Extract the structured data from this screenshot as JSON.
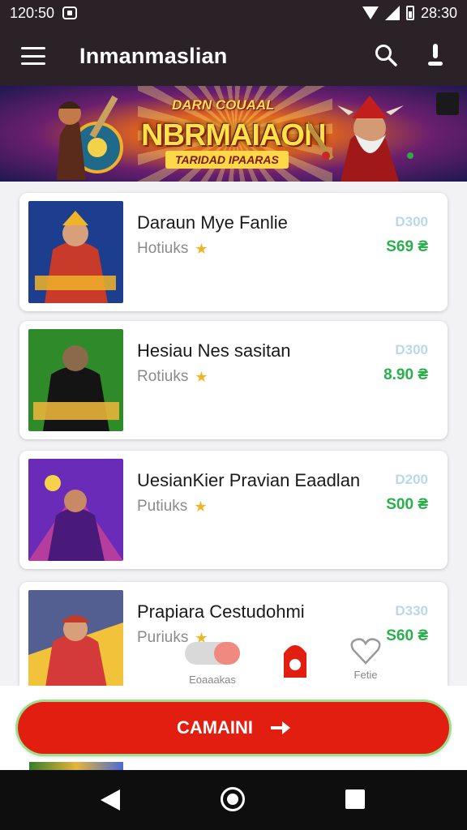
{
  "status_bar": {
    "time_left": "120:50",
    "time_right": "28:30"
  },
  "app_bar": {
    "title": "Inmanmaslian"
  },
  "banner": {
    "kicker": "DARN COUAAL",
    "headline": "NBRMAIAON",
    "subline": "TARIDAD IPAARAS"
  },
  "items": [
    {
      "title": "Daraun Mye Fanlie",
      "subtitle": "Hotiuks",
      "price_old": "D300",
      "price_new": "S69 ₴",
      "thumb_colors": [
        "#1d3d8f",
        "#c83a2a",
        "#f0b429"
      ]
    },
    {
      "title": "Hesiau Nes sasitan",
      "subtitle": "Rotiuks",
      "price_old": "D300",
      "price_new": "8.90 ₴",
      "thumb_colors": [
        "#2f8a2a",
        "#141414",
        "#e8b23a"
      ]
    },
    {
      "title": "UesianKier Pravian Eaadlan",
      "subtitle": "Putiuks",
      "price_old": "D200",
      "price_new": "S00 ₴",
      "thumb_colors": [
        "#6a2bb8",
        "#e84a8a",
        "#f5d24a"
      ]
    },
    {
      "title": "Prapiara Cestudohmi",
      "subtitle": "Puriuks",
      "price_old": "D330",
      "price_new": "S60 ₴",
      "thumb_colors": [
        "#2a46a8",
        "#d43a3a",
        "#f2c23a"
      ]
    }
  ],
  "bottom_tabs": [
    {
      "label": "Eoaaakas"
    },
    {
      "label": ""
    },
    {
      "label": "Fetie"
    }
  ],
  "cta": {
    "label": "CAMAINI"
  },
  "colors": {
    "bar": "#2a2226",
    "accent": "#e21e10",
    "price_green": "#28b14a",
    "star": "#f0b429"
  }
}
